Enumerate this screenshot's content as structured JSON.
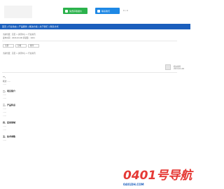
{
  "header": {
    "btn_primary": "免费获取报价",
    "btn_secondary": "联系我们",
    "counter": "0 / 0"
  },
  "nav": {
    "text": "首页 | 行业动态 | 产品服务 | 解决方案 | 关于我们 | 联系方式"
  },
  "breadcrumb": {
    "line1": "当前位置：首页 > 资讯中心 > 行业资讯",
    "line2": "发布时间：2024-04-06 阅读量：1021"
  },
  "filters": {
    "a": "全部",
    "b": "分类",
    "c": "排序"
  },
  "side": {
    "l1": "相关推荐",
    "l2": "2024-04-06"
  },
  "sections": [
    {
      "heading": "一、",
      "lines": [
        "概述 ……",
        "……"
      ]
    },
    {
      "heading": "二、项目简介",
      "lines": [
        "……",
        "……"
      ]
    },
    {
      "heading": "三、产品特点",
      "lines": [
        "……",
        "……",
        "……"
      ]
    },
    {
      "heading": "四、应用领域",
      "lines": [
        "……",
        "……"
      ]
    },
    {
      "heading": "五、技术参数",
      "lines": [
        "……"
      ]
    }
  ],
  "watermark": {
    "logo": "0401号导航",
    "url": "0401DH.COM"
  }
}
